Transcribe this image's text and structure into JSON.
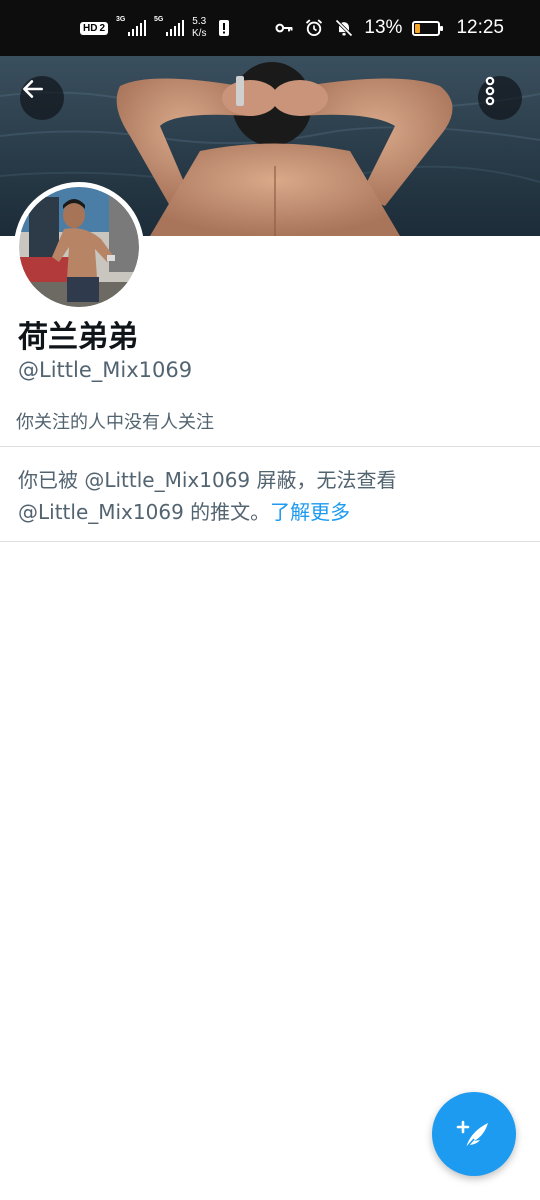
{
  "status_bar": {
    "hd_label": "HD",
    "sim_slot": "2",
    "signal1_label": "3G",
    "signal2_label": "5G",
    "net_speed_value": "5.3",
    "net_speed_unit": "K/s",
    "battery_percent": "13%",
    "time": "12:25",
    "battery_color": "#f5a623"
  },
  "header": {
    "back_icon": "arrow-left-icon",
    "more_icon": "more-vertical-icon"
  },
  "profile": {
    "display_name": "荷兰弟弟",
    "handle": "@Little_Mix1069",
    "follow_note": "你关注的人中没有人关注"
  },
  "blocked_notice": {
    "prefix": "你已被",
    "handle_1": "@Little_Mix1069",
    "middle": "屏蔽，无法查看",
    "handle_2": "@Little_Mix1069",
    "suffix": "的推文。",
    "learn_more": "了解更多"
  },
  "fab": {
    "icon": "compose-tweet-icon",
    "color": "#1d9bf0"
  }
}
